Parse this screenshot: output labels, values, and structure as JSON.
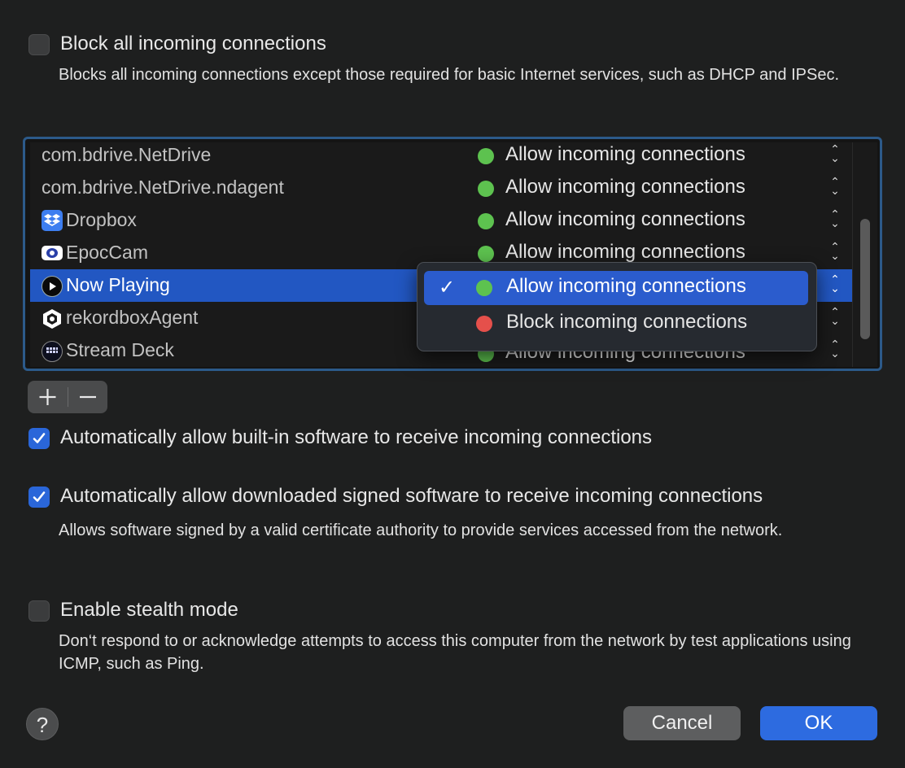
{
  "block_all": {
    "label": "Block all incoming connections",
    "checked": false,
    "description": "Blocks all incoming connections except those required for basic Internet services, such as DHCP and IPSec."
  },
  "apps": [
    {
      "name": "com.bdrive.NetDrive",
      "icon": "none",
      "status": "Allow incoming connections",
      "dot": "green",
      "selected": false
    },
    {
      "name": "com.bdrive.NetDrive.ndagent",
      "icon": "none",
      "status": "Allow incoming connections",
      "dot": "green",
      "selected": false
    },
    {
      "name": "Dropbox",
      "icon": "dropbox-icon",
      "status": "Allow incoming connections",
      "dot": "green",
      "selected": false
    },
    {
      "name": "EpocCam",
      "icon": "epoccam-icon",
      "status": "Allow incoming connections",
      "dot": "green",
      "selected": false
    },
    {
      "name": "Now Playing",
      "icon": "now-playing-icon",
      "status": "Allow incoming connections",
      "dot": "green",
      "selected": true
    },
    {
      "name": "rekordboxAgent",
      "icon": "rekordbox-icon",
      "status": "Allow incoming connections",
      "dot": "green",
      "selected": false
    },
    {
      "name": "Stream Deck",
      "icon": "stream-deck-icon",
      "status": "Allow incoming connections",
      "dot": "green",
      "selected": false
    }
  ],
  "popup": {
    "items": [
      {
        "label": "Allow incoming connections",
        "dot": "green",
        "checked": true
      },
      {
        "label": "Block incoming connections",
        "dot": "red",
        "checked": false
      }
    ]
  },
  "list_controls": {
    "add": "+",
    "remove": "−"
  },
  "auto_builtin": {
    "label": "Automatically allow built-in software to receive incoming connections",
    "checked": true
  },
  "auto_signed": {
    "label": "Automatically allow downloaded signed software to receive incoming connections",
    "checked": true,
    "description": "Allows software signed by a valid certificate authority to provide services accessed from the network."
  },
  "stealth": {
    "label": "Enable stealth mode",
    "checked": false,
    "description": "Don‘t respond to or acknowledge attempts to access this computer from the network by test applications using ICMP, such as Ping."
  },
  "buttons": {
    "help": "?",
    "cancel": "Cancel",
    "ok": "OK"
  },
  "colors": {
    "accent": "#2d6be0",
    "allow_dot": "#5dc24f",
    "block_dot": "#e5504b",
    "selection": "#2257c2"
  }
}
